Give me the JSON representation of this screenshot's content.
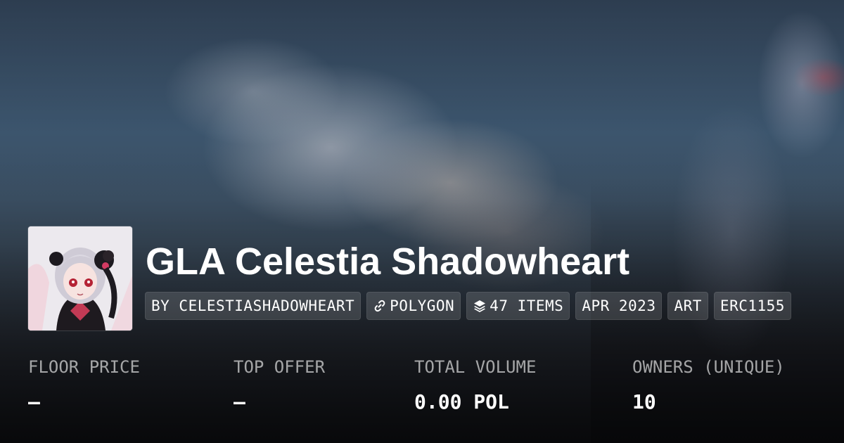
{
  "collection": {
    "title": "GLA Celestia Shadowheart",
    "avatar_alt": "collection-avatar"
  },
  "badges": [
    {
      "label": "BY CELESTIASHADOWHEART",
      "icon": ""
    },
    {
      "label": "POLYGON",
      "icon": "link-chain-icon"
    },
    {
      "label": "47 ITEMS",
      "icon": "layers-icon"
    },
    {
      "label": "APR 2023",
      "icon": ""
    },
    {
      "label": "ART",
      "icon": ""
    },
    {
      "label": "ERC1155",
      "icon": ""
    }
  ],
  "stats": [
    {
      "label": "FLOOR PRICE",
      "value": "–"
    },
    {
      "label": "TOP OFFER",
      "value": "–"
    },
    {
      "label": "TOTAL VOLUME",
      "value": "0.00 POL"
    },
    {
      "label": "OWNERS (UNIQUE)",
      "value": "10"
    }
  ],
  "colors": {
    "text": "#ffffff",
    "muted": "#bfc2c8",
    "badge_bg": "rgba(255,255,255,0.14)"
  }
}
